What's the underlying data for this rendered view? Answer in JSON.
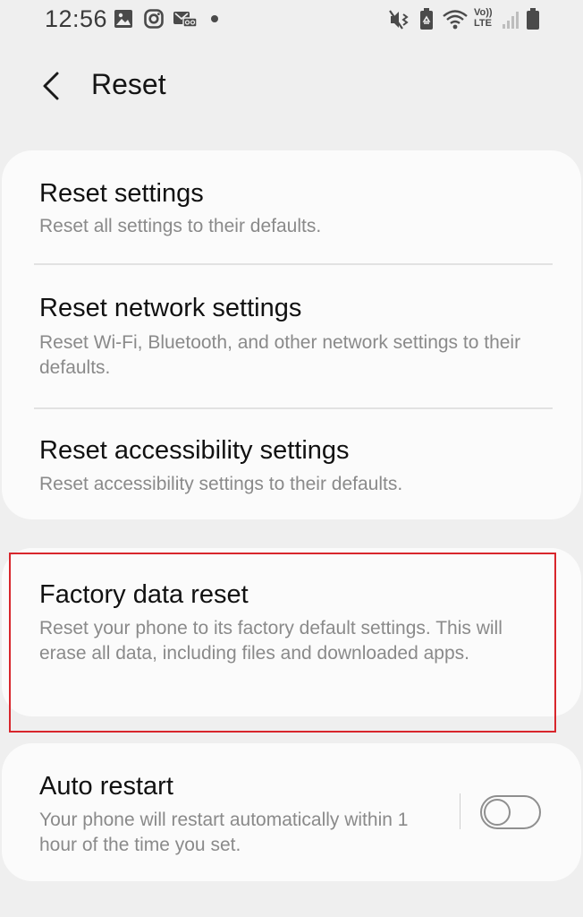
{
  "status_bar": {
    "time": "12:56",
    "left_icons": [
      "gallery-icon",
      "instagram-icon",
      "voicemail-icon",
      "dot-icon"
    ],
    "right_icons": [
      "mute-vibrate-icon",
      "battery-saver-icon",
      "wifi-icon",
      "volte-icon",
      "signal-icon",
      "battery-icon"
    ],
    "volte_label": "VoLTE",
    "volte_top": "Vo))",
    "volte_bottom": "LTE"
  },
  "header": {
    "back_icon": "chevron-left-icon",
    "title": "Reset"
  },
  "reset_group": {
    "items": [
      {
        "title": "Reset settings",
        "subtitle": "Reset all settings to their defaults."
      },
      {
        "title": "Reset network settings",
        "subtitle": "Reset Wi-Fi, Bluetooth, and other network settings to their defaults."
      },
      {
        "title": "Reset accessibility settings",
        "subtitle": "Reset accessibility settings to their defaults."
      }
    ]
  },
  "factory_reset": {
    "title": "Factory data reset",
    "subtitle": "Reset your phone to its factory default settings. This will erase all data, including files and downloaded apps.",
    "highlight_color": "#d8262c"
  },
  "auto_restart": {
    "title": "Auto restart",
    "subtitle": "Your phone will restart automatically within 1 hour of the time you set.",
    "toggle_on": false
  }
}
